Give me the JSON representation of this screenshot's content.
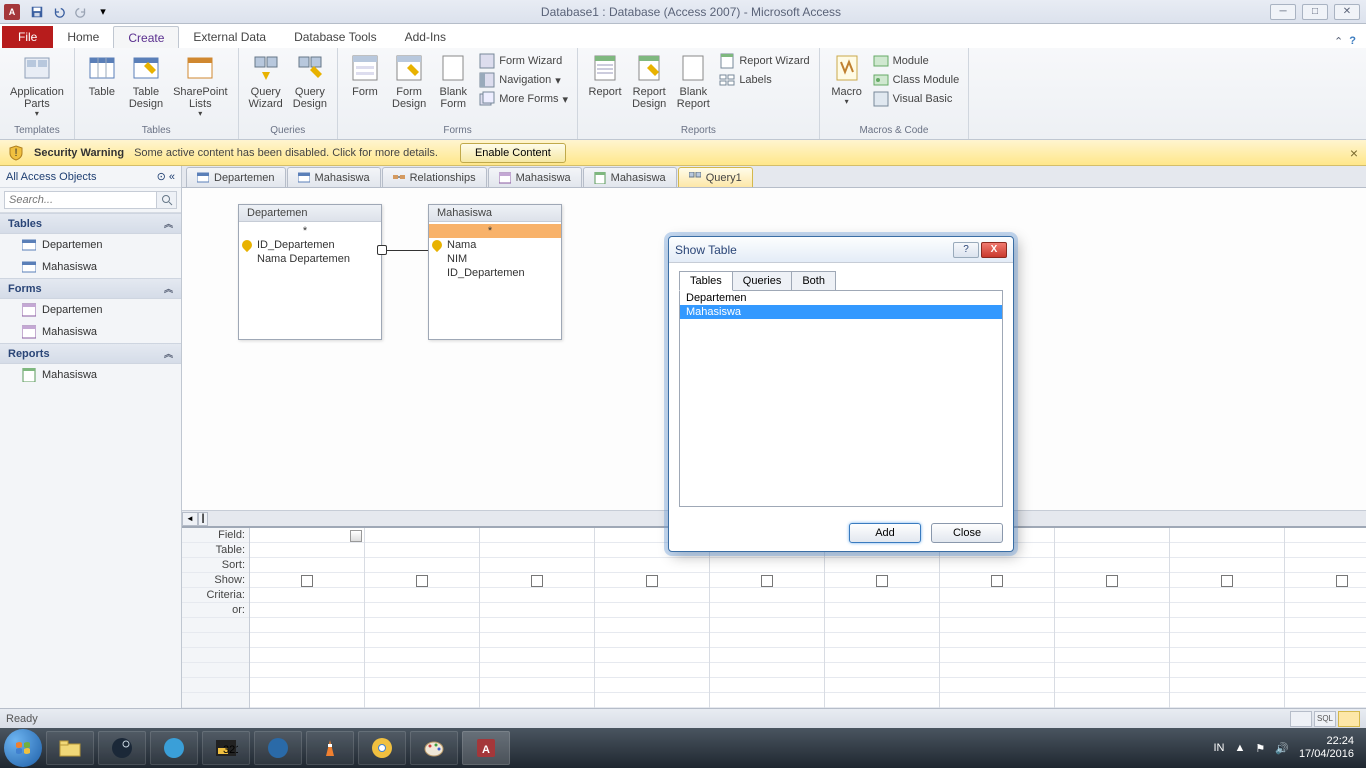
{
  "titlebar": {
    "title": "Database1 : Database (Access 2007)  -  Microsoft Access"
  },
  "tabs": {
    "file": "File",
    "list": [
      "Home",
      "Create",
      "External Data",
      "Database Tools",
      "Add-Ins"
    ],
    "active": "Create"
  },
  "ribbon": {
    "templates": {
      "label": "Templates",
      "app_parts": "Application\nParts"
    },
    "tables": {
      "label": "Tables",
      "table": "Table",
      "table_design": "Table\nDesign",
      "sp_lists": "SharePoint\nLists"
    },
    "queries": {
      "label": "Queries",
      "wizard": "Query\nWizard",
      "design": "Query\nDesign"
    },
    "forms": {
      "label": "Forms",
      "form": "Form",
      "form_design": "Form\nDesign",
      "blank_form": "Blank\nForm",
      "form_wizard": "Form Wizard",
      "navigation": "Navigation",
      "more_forms": "More Forms"
    },
    "reports": {
      "label": "Reports",
      "report": "Report",
      "report_design": "Report\nDesign",
      "blank_report": "Blank\nReport",
      "report_wizard": "Report Wizard",
      "labels": "Labels"
    },
    "macros": {
      "label": "Macros & Code",
      "macro": "Macro",
      "module": "Module",
      "class_module": "Class Module",
      "vb": "Visual Basic"
    }
  },
  "warning": {
    "title": "Security Warning",
    "msg": "Some active content has been disabled. Click for more details.",
    "enable": "Enable Content"
  },
  "nav": {
    "header": "All Access Objects",
    "search_ph": "Search...",
    "cats": {
      "tables": {
        "label": "Tables",
        "items": [
          "Departemen",
          "Mahasiswa"
        ]
      },
      "forms": {
        "label": "Forms",
        "items": [
          "Departemen",
          "Mahasiswa"
        ]
      },
      "reports": {
        "label": "Reports",
        "items": [
          "Mahasiswa"
        ]
      }
    }
  },
  "doc_tabs": [
    "Departemen",
    "Mahasiswa",
    "Relationships",
    "Mahasiswa",
    "Mahasiswa",
    "Query1"
  ],
  "tables_on_surface": {
    "dep": {
      "title": "Departemen",
      "fields": [
        "*",
        "ID_Departemen",
        "Nama Departemen"
      ]
    },
    "mah": {
      "title": "Mahasiswa",
      "fields": [
        "*",
        "Nama",
        "NIM",
        "ID_Departemen"
      ]
    }
  },
  "qgrid_labels": [
    "Field:",
    "Table:",
    "Sort:",
    "Show:",
    "Criteria:",
    "or:"
  ],
  "dialog": {
    "title": "Show Table",
    "tabs": [
      "Tables",
      "Queries",
      "Both"
    ],
    "items": [
      "Departemen",
      "Mahasiswa"
    ],
    "selected": "Mahasiswa",
    "add": "Add",
    "close": "Close"
  },
  "status": {
    "ready": "Ready",
    "sql": "SQL"
  },
  "tray": {
    "lang": "IN",
    "time": "22:24",
    "date": "17/04/2016"
  }
}
